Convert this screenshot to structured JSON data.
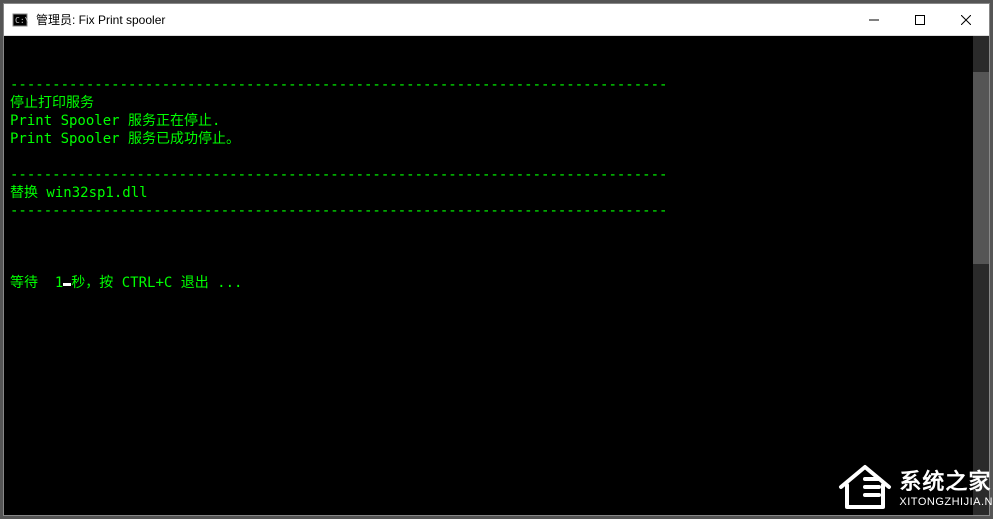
{
  "titlebar": {
    "title": "管理员:  Fix Print spooler"
  },
  "terminal": {
    "lines": [
      "------------------------------------------------------------------------------",
      "停止打印服务",
      "Print Spooler 服务正在停止.",
      "Print Spooler 服务已成功停止。",
      "",
      "------------------------------------------------------------------------------",
      "替换 win32sp1.dll",
      "------------------------------------------------------------------------------",
      ""
    ],
    "cursor_prefix": "等待  1",
    "cursor_suffix": "秒，按 CTRL+C 退出 ..."
  },
  "watermark": {
    "cn": "系统之家",
    "en": "XITONGZHIJIA.N"
  },
  "colors": {
    "terminal_bg": "#000000",
    "terminal_fg": "#00ff00"
  }
}
